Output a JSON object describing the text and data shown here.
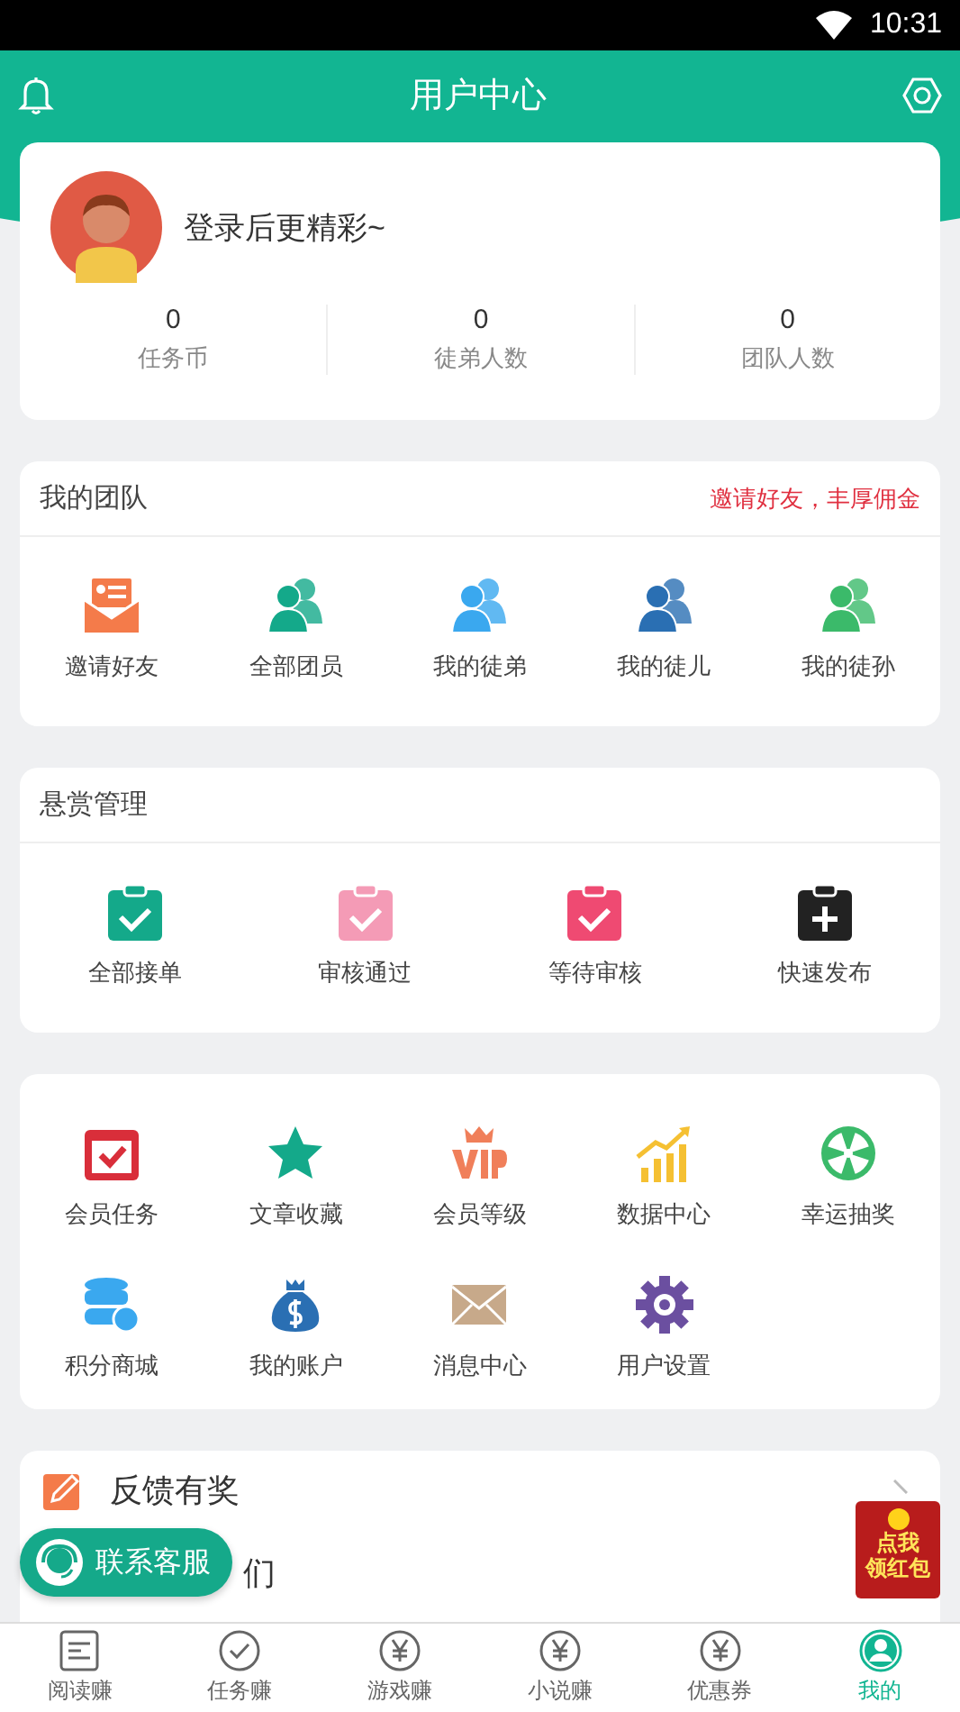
{
  "status_bar": {
    "time": "10:31"
  },
  "header": {
    "title": "用户中心"
  },
  "profile": {
    "prompt": "登录后更精彩~",
    "stats": [
      {
        "value": "0",
        "label": "任务币"
      },
      {
        "value": "0",
        "label": "徒弟人数"
      },
      {
        "value": "0",
        "label": "团队人数"
      }
    ]
  },
  "team": {
    "title": "我的团队",
    "link": "邀请好友，丰厚佣金",
    "items": [
      {
        "label": "邀请好友",
        "kind": "invite",
        "color": "#f47b4a"
      },
      {
        "label": "全部团员",
        "kind": "people",
        "color": "#14a98a"
      },
      {
        "label": "我的徒弟",
        "kind": "people",
        "color": "#3aa8ef"
      },
      {
        "label": "我的徒儿",
        "kind": "people",
        "color": "#2a6fb3"
      },
      {
        "label": "我的徒孙",
        "kind": "people",
        "color": "#3bba6a"
      }
    ]
  },
  "reward": {
    "title": "悬赏管理",
    "items": [
      {
        "label": "全部接单",
        "kind": "check",
        "color": "#14a98a"
      },
      {
        "label": "审核通过",
        "kind": "check",
        "color": "#f49bb6"
      },
      {
        "label": "等待审核",
        "kind": "check",
        "color": "#ef4a72"
      },
      {
        "label": "快速发布",
        "kind": "plus",
        "color": "#222222"
      }
    ]
  },
  "tools": {
    "items": [
      {
        "label": "会员任务"
      },
      {
        "label": "文章收藏"
      },
      {
        "label": "会员等级"
      },
      {
        "label": "数据中心"
      },
      {
        "label": "幸运抽奖"
      },
      {
        "label": "积分商城"
      },
      {
        "label": "我的账户"
      },
      {
        "label": "消息中心"
      },
      {
        "label": "用户设置"
      }
    ]
  },
  "feedback": {
    "title": "反馈有奖",
    "row_2": "们"
  },
  "service_button": {
    "label": "联系客服"
  },
  "red_packet": {
    "lines": [
      "点我",
      "领红包"
    ]
  },
  "tabs": [
    {
      "label": "阅读赚",
      "selected": false
    },
    {
      "label": "任务赚",
      "selected": false
    },
    {
      "label": "游戏赚",
      "selected": false
    },
    {
      "label": "小说赚",
      "selected": false
    },
    {
      "label": "优惠券",
      "selected": false
    },
    {
      "label": "我的",
      "selected": true
    }
  ]
}
